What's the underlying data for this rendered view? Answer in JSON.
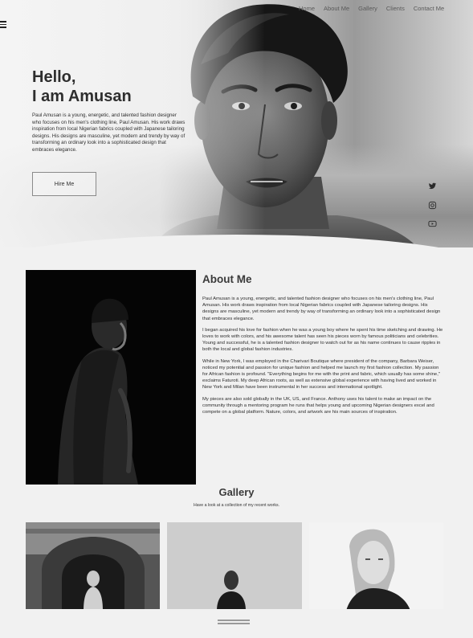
{
  "nav": {
    "items": [
      "Home",
      "About Me",
      "Gallery",
      "Clients",
      "Contact Me"
    ]
  },
  "hero": {
    "title": "Hello,\nI am Amusan",
    "bio": "Paul Amusan is a young, energetic, and talented fashion designer who focuses on his men's clothing line, Paul Amusan. His work draws inspiration from local Nigerian fabrics coupled with Japanese tailoring designs. His designs are masculine, yet modern and trendy by way of transforming an ordinary look into a sophisticated design that embraces elegance.",
    "button_label": "Hire Me"
  },
  "social": {
    "icons": [
      "twitter-icon",
      "instagram-icon",
      "youtube-icon"
    ]
  },
  "about": {
    "title": "About Me",
    "paragraphs": [
      "Paul Amusan is a young, energetic, and talented fashion designer who focuses on his men's clothing line, Paul Amusan. His work draws inspiration from local Nigerian fabrics coupled with Japanese tailoring designs. His designs are masculine, yet modern and trendy by way of transforming an ordinary look into a sophisticated design that embraces elegance.",
      "I began acquired his love for fashion when he was a young boy where he spent his time sketching and drawing. He loves to work with colors, and his awesome talent has seen his pieces worn by famous politicians and celebrities. Young and successful, he is a talented fashion designer to watch out for as his name continues to cause ripples in both the local and global fashion industries.",
      "While in New York, I was employed in the Charivari Boutique where president of the company, Barbara Weiser, noticed my potential and passion for unique fashion and helped me launch my first fashion collection. My passion for African fashion is profound. \"Everything begins for me with the print and fabric, which usually has some shine,\" exclaims Faturoti. My deep African roots, as well as extensive global experience with having lived and worked in New York and Milan have been instrumental in her success and international spotlight.",
      "My pieces are also sold globally in the UK, US, and France. Anthony uses his talent to make an impact on the community through a mentoring program he runs that helps young and upcoming Nigerian designers excel and compete on a global platform. Nature, colors, and artwork are his main sources of inspiration."
    ]
  },
  "gallery": {
    "title": "Gallery",
    "subtitle": "Have a look at a collection of my recent works."
  }
}
